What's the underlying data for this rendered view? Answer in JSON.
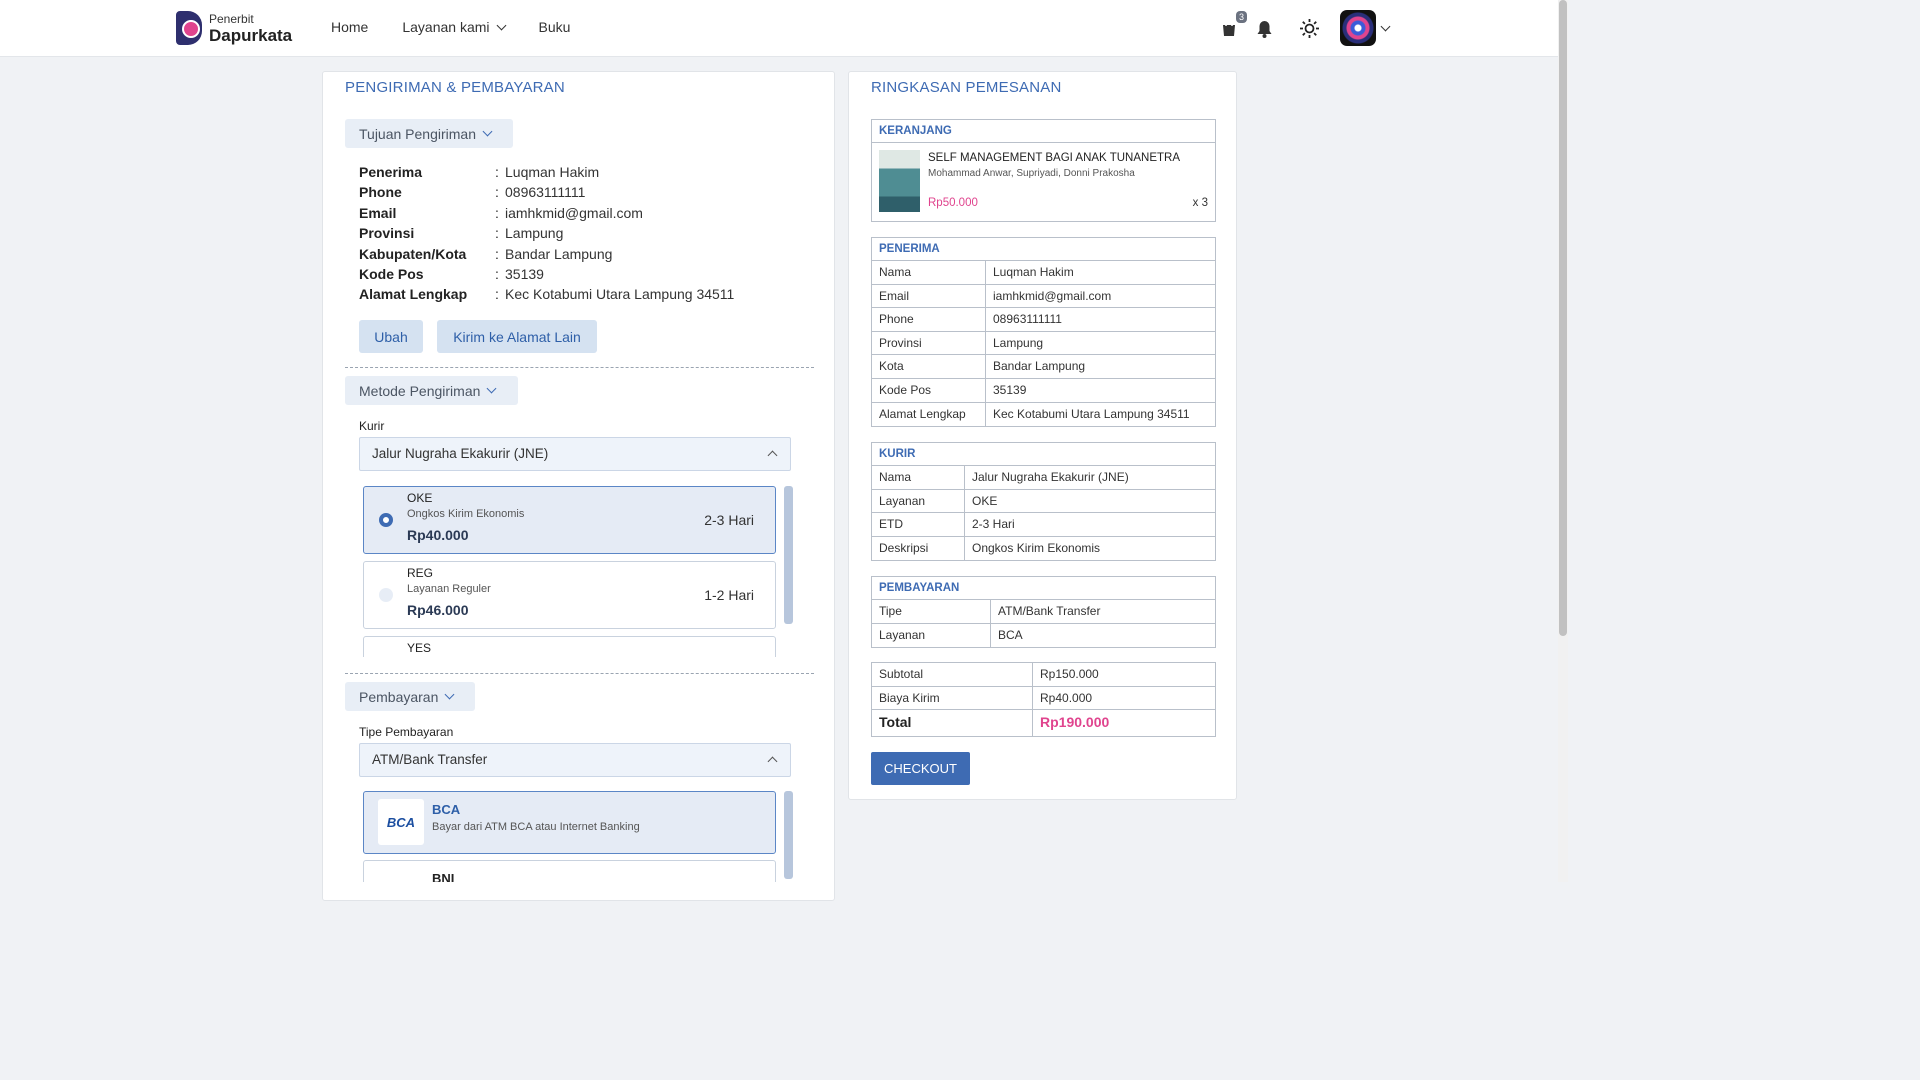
{
  "navbar": {
    "logo_small": "Penerbit",
    "logo_big": "Dapurkata",
    "links": [
      "Home",
      "Layanan kami",
      "Buku"
    ],
    "cart_count": "3"
  },
  "left": {
    "title": "PENGIRIMAN & PEMBAYARAN",
    "address_toggle": "Tujuan Pengiriman",
    "address": [
      {
        "label": "Penerima",
        "value": "Luqman Hakim"
      },
      {
        "label": "Phone",
        "value": "08963111111"
      },
      {
        "label": "Email",
        "value": "iamhkmid@gmail.com"
      },
      {
        "label": "Provinsi",
        "value": "Lampung"
      },
      {
        "label": "Kabupaten/Kota",
        "value": "Bandar Lampung"
      },
      {
        "label": "Kode Pos",
        "value": "35139"
      },
      {
        "label": "Alamat Lengkap",
        "value": "Kec Kotabumi Utara Lampung 34511"
      }
    ],
    "edit_button": "Ubah",
    "other_address_button": "Kirim ke Alamat Lain",
    "shipping_toggle": "Metode Pengiriman",
    "courier_label": "Kurir",
    "courier_value": "Jalur Nugraha Ekakurir (JNE)",
    "services": [
      {
        "code": "OKE",
        "desc": "Ongkos Kirim Ekonomis",
        "price": "Rp40.000",
        "etd": "2-3 Hari"
      },
      {
        "code": "REG",
        "desc": "Layanan Reguler",
        "price": "Rp46.000",
        "etd": "1-2 Hari"
      },
      {
        "code": "YES",
        "desc": "",
        "price": "",
        "etd": ""
      }
    ],
    "payment_toggle": "Pembayaran",
    "payment_type_label": "Tipe Pembayaran",
    "payment_type_value": "ATM/Bank Transfer",
    "banks": [
      {
        "name": "BCA",
        "desc": "Bayar dari ATM BCA atau Internet Banking",
        "logo": "BCA"
      },
      {
        "name": "BNI",
        "desc": "",
        "logo": ""
      }
    ]
  },
  "summary": {
    "title": "RINGKASAN PEMESANAN",
    "cart_head": "KERANJANG",
    "book_title": "SELF MANAGEMENT BAGI ANAK TUNANETRA",
    "book_authors": "Mohammad Anwar, Supriyadi, Donni Prakosha",
    "book_price": "Rp50.000",
    "book_qty": "x 3",
    "recipient_head": "PENERIMA",
    "recipient": [
      {
        "k": "Nama",
        "v": "Luqman Hakim"
      },
      {
        "k": "Email",
        "v": "iamhkmid@gmail.com"
      },
      {
        "k": "Phone",
        "v": "08963111111"
      },
      {
        "k": "Provinsi",
        "v": "Lampung"
      },
      {
        "k": "Kota",
        "v": "Bandar Lampung"
      },
      {
        "k": "Kode Pos",
        "v": "35139"
      },
      {
        "k": "Alamat Lengkap",
        "v": "Kec Kotabumi Utara Lampung 34511"
      }
    ],
    "courier_head": "KURIR",
    "courier": [
      {
        "k": "Nama",
        "v": "Jalur Nugraha Ekakurir (JNE)"
      },
      {
        "k": "Layanan",
        "v": "OKE"
      },
      {
        "k": "ETD",
        "v": "2-3 Hari"
      },
      {
        "k": "Deskripsi",
        "v": "Ongkos Kirim Ekonomis"
      }
    ],
    "payment_head": "PEMBAYARAN",
    "payment": [
      {
        "k": "Tipe",
        "v": "ATM/Bank Transfer"
      },
      {
        "k": "Layanan",
        "v": "BCA"
      }
    ],
    "totals": [
      {
        "k": "Subtotal",
        "v": "Rp150.000"
      },
      {
        "k": "Biaya Kirim",
        "v": "Rp40.000"
      },
      {
        "k": "Total",
        "v": "Rp190.000"
      }
    ],
    "checkout": "CHECKOUT"
  },
  "colors": {
    "accent": "#3e6bb3",
    "pink": "#e0448e"
  }
}
